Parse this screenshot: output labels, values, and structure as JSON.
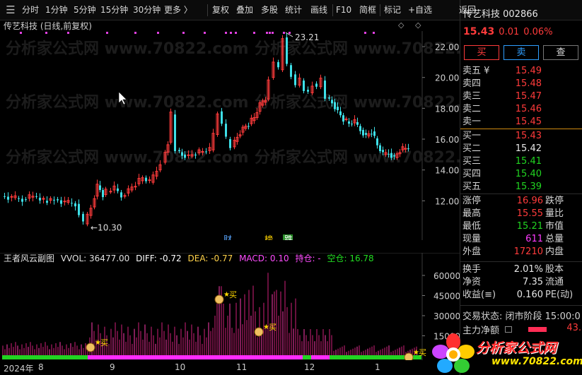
{
  "toolbar": {
    "items": [
      "分时",
      "1分钟",
      "5分钟",
      "15分钟",
      "30分钟",
      "更多 〉",
      "复权",
      "叠加",
      "多股",
      "统计",
      "画线",
      "F10",
      "简框",
      "标记",
      "+自选"
    ],
    "back": "返回"
  },
  "chart": {
    "stock_title": "传艺科技 (日线,前复权)",
    "controls": "◇ ◇",
    "high_label": "23.21",
    "low_label": "10.30",
    "y_ticks": [
      "22.00",
      "20.00",
      "18.00",
      "16.00",
      "14.00",
      "12.00"
    ],
    "event_labels": [
      "财",
      "榜",
      "跌"
    ]
  },
  "indicator": {
    "name": "王者风云副图",
    "vvol": "VVOL: 36477.00",
    "diff": "DIFF: -0.72",
    "dea": "DEA: -0.77",
    "macd": "MACD: 0.10",
    "hold": "持仓: -",
    "empty": "空仓: 16.78",
    "y_ticks": [
      "60000",
      "45000",
      "30000",
      "15000"
    ],
    "signal_label": "买",
    "colors": {
      "vvol": "#e8e8e8",
      "diff": "#ffffff",
      "dea": "#ffd24a",
      "macd": "#ff4cff",
      "hold": "#ff4cff",
      "empty": "#22dd22"
    }
  },
  "timeline": {
    "labels": [
      "2024年",
      "8",
      "9",
      "10",
      "11",
      "12",
      "1"
    ]
  },
  "quote": {
    "name": "传艺科技 002866",
    "price": "15.43",
    "change": "0.01",
    "change_pct": "0.06%",
    "buy_btn": "买",
    "sell_btn": "卖",
    "query_btn": "查",
    "asks": [
      {
        "label": "卖五 ¥",
        "value": "15.49"
      },
      {
        "label": "卖四",
        "value": "15.48"
      },
      {
        "label": "卖三",
        "value": "15.47"
      },
      {
        "label": "卖二",
        "value": "15.46"
      },
      {
        "label": "卖一",
        "value": "15.45"
      }
    ],
    "bids": [
      {
        "label": "买一",
        "value": "15.43"
      },
      {
        "label": "买二",
        "value": "15.42"
      },
      {
        "label": "买三",
        "value": "15.41"
      },
      {
        "label": "买四",
        "value": "15.40"
      },
      {
        "label": "买五",
        "value": "15.39"
      }
    ],
    "stats": [
      {
        "l1": "涨停",
        "v1": "16.96",
        "l2": "跌停"
      },
      {
        "l1": "最高",
        "v1": "15.55",
        "l2": "量比"
      },
      {
        "l1": "最低",
        "v1": "15.21",
        "l2": "市值"
      },
      {
        "l1": "现量",
        "v1": "611",
        "l2": "总量"
      },
      {
        "l1": "外盘",
        "v1": "17210",
        "l2": "内盘"
      }
    ],
    "stats2": [
      {
        "l1": "换手",
        "v1": "2.01%",
        "l2": "股本"
      },
      {
        "l1": "净资",
        "v1": "7.35",
        "l2": "流通"
      },
      {
        "l1": "收益(≡)",
        "v1": "0.160",
        "l2": "PE(动)"
      }
    ],
    "trade_status": "交易状态: 闭市阶段 15:00:0",
    "main_flow_label": "主力净额",
    "main_flow_value": "43."
  },
  "watermark": {
    "text": "分析家公式网 www.70822.com",
    "logo_text": "分析家公式网",
    "logo_url": "www.70822.com"
  },
  "colors": {
    "up": "#ff3b3b",
    "down": "#3ee0e8",
    "green": "#21d421",
    "magenta": "#ff2bff",
    "white_value": "#e6e6e6"
  }
}
